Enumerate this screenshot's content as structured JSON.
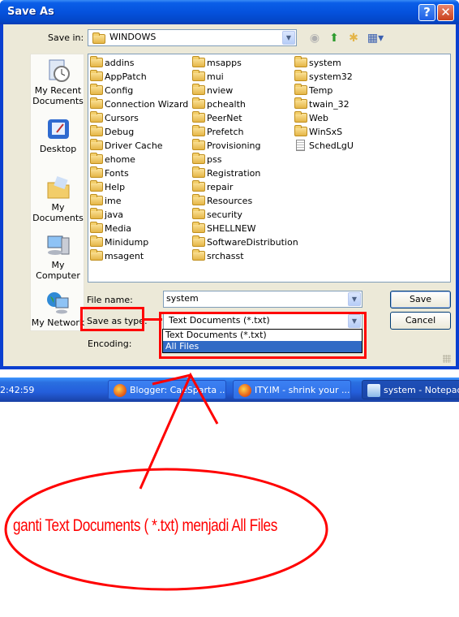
{
  "window": {
    "title": "Save As",
    "help_label": "?",
    "close_label": "✕"
  },
  "toolbar": {
    "save_in_label": "Save in:",
    "save_in_value": "WINDOWS",
    "back_icon": "back-arrow-icon",
    "up_icon": "up-folder-icon",
    "new_folder_icon": "new-folder-icon",
    "views_icon": "views-menu-icon"
  },
  "places": [
    {
      "label": "My Recent\nDocuments",
      "icon": "recent-documents-icon"
    },
    {
      "label": "Desktop",
      "icon": "desktop-icon"
    },
    {
      "label": "My Documents",
      "icon": "my-documents-icon"
    },
    {
      "label": "My Computer",
      "icon": "my-computer-icon"
    },
    {
      "label": "My Network",
      "icon": "my-network-icon"
    }
  ],
  "files": {
    "col1": [
      "addins",
      "AppPatch",
      "Config",
      "Connection Wizard",
      "Cursors",
      "Debug",
      "Driver Cache",
      "ehome",
      "Fonts",
      "Help",
      "ime",
      "java",
      "Media",
      "Minidump",
      "msagent"
    ],
    "col2": [
      "msapps",
      "mui",
      "nview",
      "pchealth",
      "PeerNet",
      "Prefetch",
      "Provisioning",
      "pss",
      "Registration",
      "repair",
      "Resources",
      "security",
      "SHELLNEW",
      "SoftwareDistribution",
      "srchasst"
    ],
    "col3": [
      "system",
      "system32",
      "Temp",
      "twain_32",
      "Web",
      "WinSxS"
    ],
    "col3_file": "SchedLgU"
  },
  "form": {
    "file_name_label": "File name:",
    "file_name_value": "system",
    "save_type_label": "Save as type:",
    "save_type_value": "Text Documents (*.txt)",
    "encoding_label": "Encoding:",
    "options": [
      "Text Documents (*.txt)",
      "All Files"
    ],
    "highlighted_option": "All Files",
    "save_button": "Save",
    "cancel_button": "Cancel"
  },
  "taskbar": {
    "clock": "2:42:59",
    "items": [
      {
        "label": "Blogger: CaeSparta ...",
        "icon": "firefox-icon",
        "active": false
      },
      {
        "label": "ITY.IM - shrink your ...",
        "icon": "firefox-icon",
        "active": false
      },
      {
        "label": "system - Notepad",
        "icon": "notepad-icon",
        "active": true
      }
    ]
  },
  "annotation": {
    "text": "ganti Text Documents ( *.txt) menjadi All Files",
    "color": "#ff0000"
  }
}
